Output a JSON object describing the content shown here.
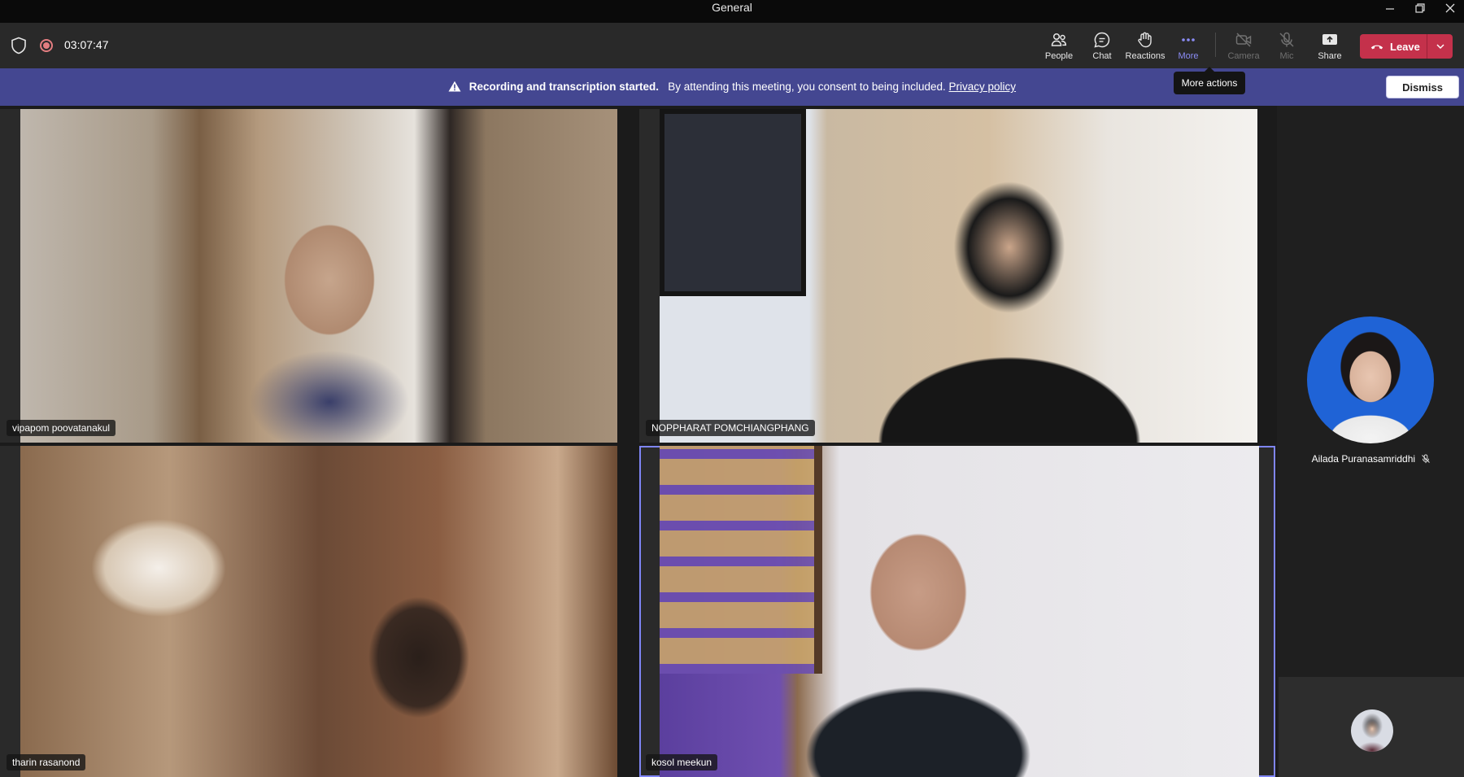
{
  "window": {
    "title": "General"
  },
  "topbar": {
    "timer": "03:07:47",
    "buttons": {
      "people": "People",
      "chat": "Chat",
      "reactions": "Reactions",
      "more": "More",
      "camera": "Camera",
      "mic": "Mic",
      "share": "Share"
    },
    "leave": "Leave",
    "tooltip": "More actions"
  },
  "banner": {
    "bold": "Recording and transcription started.",
    "text": "By attending this meeting, you consent to being included.",
    "link": "Privacy policy",
    "dismiss": "Dismiss"
  },
  "participants": [
    {
      "name": "vipapom poovatanakul"
    },
    {
      "name": "NOPPHARAT POMCHIANGPHANG"
    },
    {
      "name": "tharin rasanond"
    },
    {
      "name": "kosol meekun",
      "speaking": true
    }
  ],
  "side_participant": {
    "name": "Ailada Puranasamriddhi",
    "muted": true
  },
  "colors": {
    "accent": "#444791",
    "leave": "#c4314b",
    "active": "#8b8cf5"
  }
}
